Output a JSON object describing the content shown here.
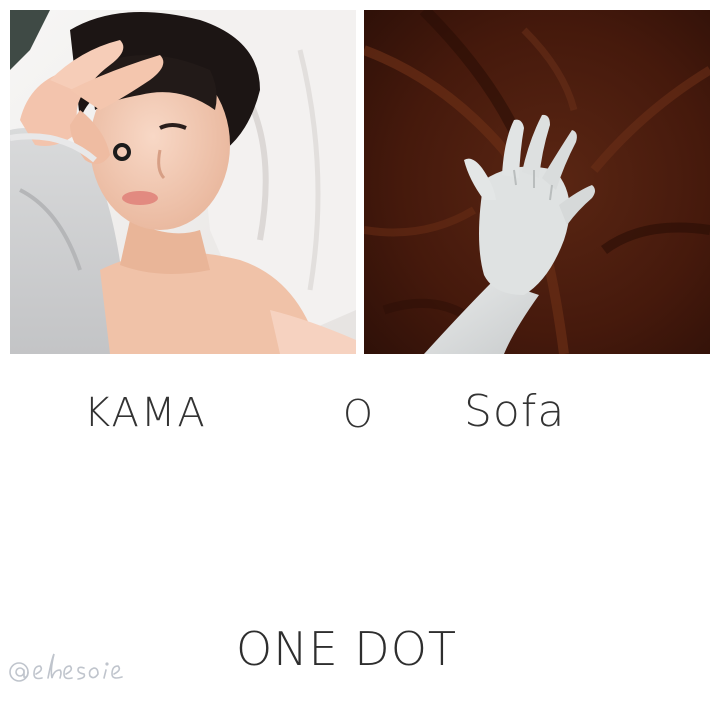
{
  "photos": {
    "left": {
      "subject": "person-lying-in-bed-peace-sign"
    },
    "right": {
      "subject": "hand-grasping-dark-brown-sheet"
    }
  },
  "labels": {
    "left": "KAMA",
    "middle": "O",
    "right": "Sofa"
  },
  "footer": {
    "title": "ONE DOT"
  },
  "watermark": {
    "text": "@ehesoie"
  },
  "colors": {
    "background": "#ffffff",
    "text": "#333333",
    "sheet": "#4a1e10",
    "pillow": "#f1efee",
    "skin": "#f2c9b2",
    "hair": "#1c1514"
  }
}
